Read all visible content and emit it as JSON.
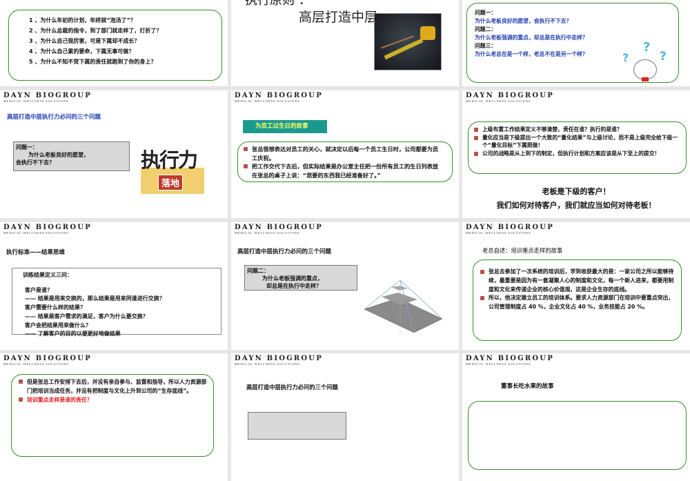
{
  "brand": {
    "name": "DAYN BIOGROUP",
    "tagline": "MEDICAL WELLNESS SOLUTIONS"
  },
  "slides": [
    {
      "questions": [
        "1 、为什么年初的计划，年终就“泡汤了”？",
        "2 、为什么总裁的指令，到了部门就走样了，打折了？",
        "3 、为什么自己很厉害，可是下属却不成长？",
        "4 、为什么自己累的要命，下属无事可做？",
        "5 、为什么不知不觉下属的责任就跑到了你的身上？"
      ]
    },
    {
      "heading": "执行原则 ：",
      "subheading": "高层打造中层"
    },
    {
      "lines": [
        "问题一：",
        "为什么老板良好的愿望，会执行不下去？",
        "问题二：",
        "为什么老板强调的重点，却总是在执行中走样？",
        "问题三：",
        "为什么老总在是一个样，老总不在是另一个样？"
      ]
    },
    {
      "title": "高层打造中层执行力必问的三个问题",
      "box": [
        "问题一：",
        "为什么老板良好的愿望，",
        "会执行不下去？"
      ],
      "image_text": [
        "执行力",
        "落地"
      ]
    },
    {
      "banner": "为员工过生日的故事",
      "bullets": [
        "张总很想表达对员工的关心，就决定以后每一个员工生日时，公司都要为员工庆祝。",
        "把工作交代下去后，但实际结果是办公室主任把一份所有员工的生日列表放在张总的桌子上说：“您要的东西我已经准备好了。”"
      ]
    },
    {
      "bullets": [
        "上级布置工作结果定义不够清楚，责任在谁？执行的是谁？",
        "量化应当是下级提出一个大致的“量化结果”与上级讨论，而不是上级完全给下级一个“量化目标”下属照做！",
        "公司的战略是从上到下的制定，但执行计划和方案应该是从下至上的提交！"
      ],
      "closing": [
        "老板是下级的客户！",
        "我们如何对待客户，我们就应当如何对待老板！"
      ]
    },
    {
      "title": "执行标准——结果思维",
      "box": [
        "训练结果定义三问：",
        "客户是谁？",
        "—— 结果是用来交换的，那么结果是用来同谁进行交换？",
        "客户需要什么样的结果？",
        "—— 结果是客户需求的满足，客户为什么要交换？",
        "客户会把结果用来做什么？",
        "—— 了解客户的目的以便更好地做结果"
      ]
    },
    {
      "title": "高层打造中层执行力必问的三个问题",
      "box": [
        "问题二：",
        "为什么老板强调的重点，",
        "却总是在执行中走样？"
      ]
    },
    {
      "title": "老总自述：培训重点走样的故事",
      "bullets": [
        "张总去参加了一次系统的培训后，学到收获最大的是：一家公司之所以能够持续，最重要是因为有一套凝聚人心的制度和文化，每一个新人进来，都要用制度和文化来传递企业的核心价值观，这是企业生存的底线。",
        "所以，他决定建立员工的培训体系。要求人力资源部门在培训中要重点突出，公司管理制度占 40 %，企业文化占 40 %，业务技能占 20 %。"
      ]
    },
    {
      "bullets": [
        "但是张总工作安排下去后，并没有亲自参与、监督和指导，所以人力资源部门把培训当成任务，并没有把制度与文化上升到公司的“生存底线”。",
        "培训重点走样是谁的责任？"
      ]
    },
    {
      "title": "高层打造中层执行力必问的三个问题"
    },
    {
      "title": "董事长吃水果的故事"
    }
  ],
  "colors": {
    "green": "#3a8a2e",
    "blue": "#1f3fae",
    "teal": "#1a9a8f",
    "red": "#e02020"
  }
}
